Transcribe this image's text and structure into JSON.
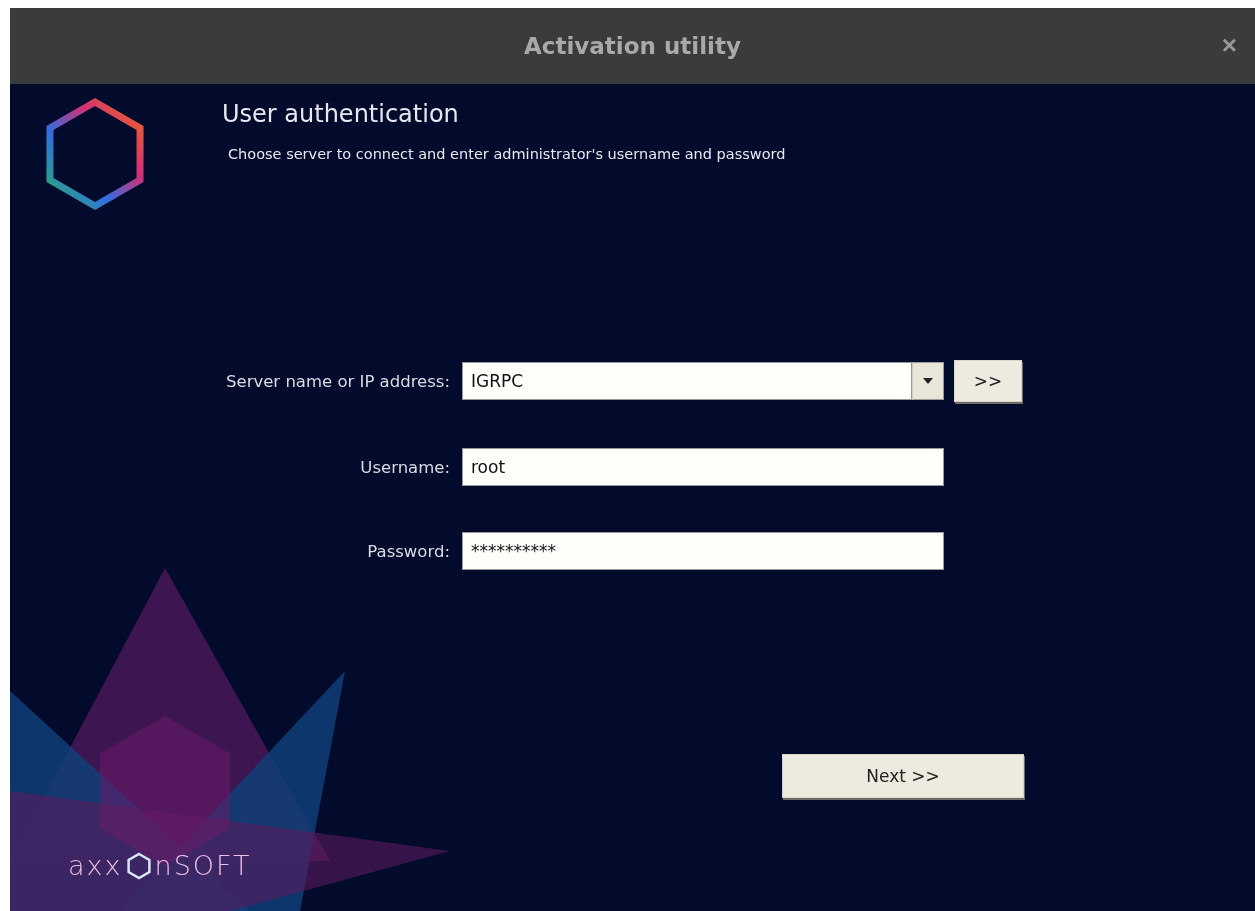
{
  "window": {
    "title": "Activation utility",
    "close": "×"
  },
  "header": {
    "title": "User authentication",
    "subtitle": "Choose server to connect and enter administrator's username and password"
  },
  "fields": [
    {
      "kind": "combo",
      "label": "Server name or IP address:",
      "value": "IGRPC",
      "action": ">>"
    },
    {
      "kind": "text",
      "label": "Username:",
      "value": "root"
    },
    {
      "kind": "text",
      "label": "Password:",
      "value": "**********"
    }
  ],
  "next_button": "Next >>",
  "logo": {
    "before": "axx",
    "after": "nSOFT"
  }
}
